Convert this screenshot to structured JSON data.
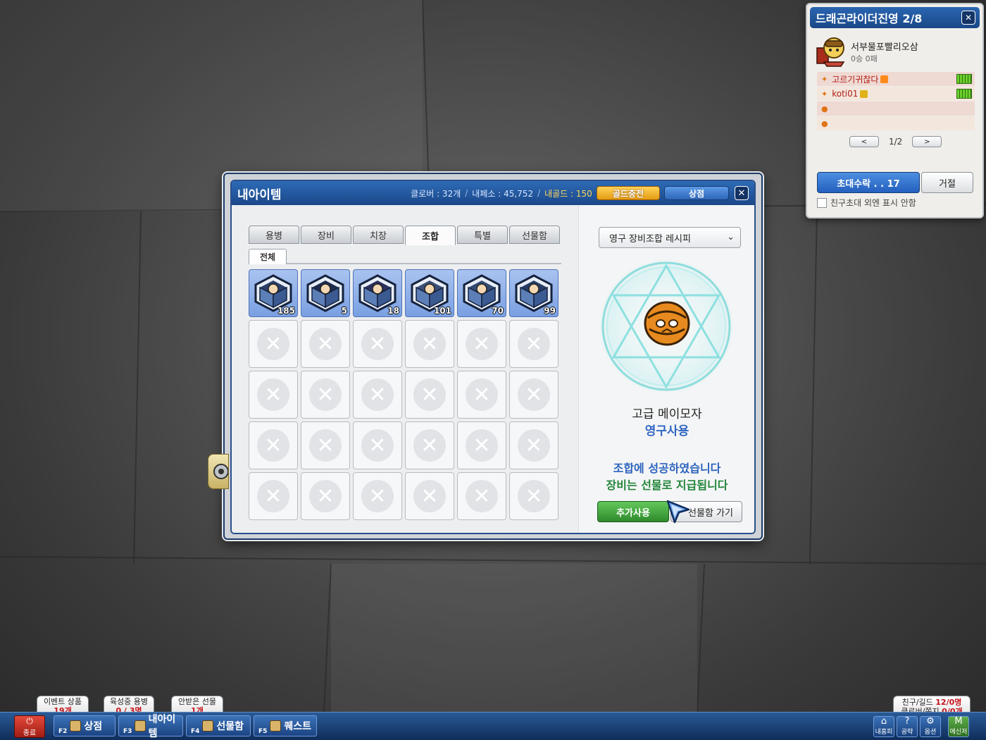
{
  "main_window": {
    "title": "내아이템",
    "stats": {
      "clover": "클로버 : 32개",
      "coins": "내페소 : 45,752",
      "gold": "내골드 : 150"
    },
    "gold_charge_label": "골드충전",
    "shop_label": "상점",
    "close_label": "✕"
  },
  "tabs": [
    {
      "label": "용병",
      "active": false
    },
    {
      "label": "장비",
      "active": false
    },
    {
      "label": "치장",
      "active": false
    },
    {
      "label": "조합",
      "active": true
    },
    {
      "label": "특별",
      "active": false
    },
    {
      "label": "선물함",
      "active": false
    }
  ],
  "subtab": "전체",
  "inventory": {
    "counts": [
      "185",
      "5",
      "18",
      "101",
      "70",
      "99"
    ],
    "empty_slot_icon": "empty-x-icon"
  },
  "recipe": {
    "select_value": "영구 장비조합 레시피",
    "item_name": "고급 메이모자",
    "item_duration": "영구사용",
    "message_success": "조합에 성공하였습니다",
    "message_gift": "장비는 선물로 지급됩니다",
    "extra_use_label": "추가사용",
    "goto_gift_label": "선물함 가기"
  },
  "invite": {
    "title": "드래곤라이더진영 2/8",
    "host_name": "서부물포빨리오삼",
    "host_record": "0승 0패",
    "members": [
      {
        "name": "고르기귀찮다",
        "has_bar": true
      },
      {
        "name": "koti01",
        "has_bar": true
      },
      {
        "name": "",
        "has_bar": false
      },
      {
        "name": "",
        "has_bar": false
      }
    ],
    "page": "1/2",
    "prev_label": "<",
    "next_label": ">",
    "accept_label": "초대수락 . . 17",
    "reject_label": "거절",
    "hide_label": "친구초대 외엔 표시 안함"
  },
  "taskbar": {
    "quit_label": "종료",
    "items": [
      {
        "key": "F2",
        "label": "상점"
      },
      {
        "key": "F3",
        "label": "내아이템"
      },
      {
        "key": "F4",
        "label": "선물함"
      },
      {
        "key": "F5",
        "label": "퀘스트"
      }
    ],
    "bubbles": [
      {
        "title": "이벤트 상품",
        "value": "19개"
      },
      {
        "title": "육성중 용병",
        "value": "0 / 3명"
      },
      {
        "title": "안받은 선물",
        "value": "1개"
      }
    ],
    "friend_info": {
      "line1_label": "친구/길드",
      "line1_value": "12/0명",
      "line2_label": "클로버/쪽지",
      "line2_value": "0/0개"
    },
    "right_icons": [
      {
        "label": "내홈피",
        "icon": "home-icon"
      },
      {
        "label": "공략",
        "icon": "help-icon"
      },
      {
        "label": "옵션",
        "icon": "gear-icon"
      },
      {
        "label": "메신저",
        "icon": "messenger-icon"
      }
    ]
  },
  "colors": {
    "title_blue": "#1b4789",
    "accent_gold": "#ffd65a",
    "success_blue": "#2d64be",
    "success_green": "#23863a",
    "member_red": "#b01d14"
  }
}
